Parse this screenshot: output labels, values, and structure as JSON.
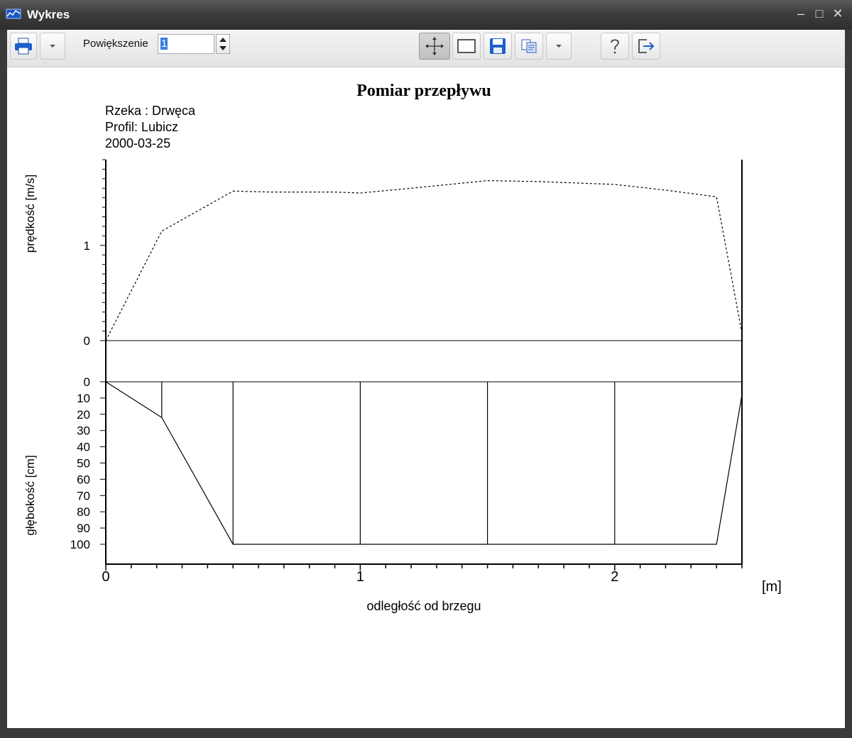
{
  "window": {
    "title": "Wykres",
    "accent": "#2a6fdb"
  },
  "toolbar": {
    "zoom_label": "Powiększenie",
    "zoom_value": "1",
    "icons": [
      "print-icon",
      "dropdown-icon",
      "pan-icon",
      "select-rect-icon",
      "save-icon",
      "copy-icon",
      "dropdown-icon",
      "help-icon",
      "exit-icon"
    ]
  },
  "chart_data": {
    "type": "line",
    "title": "Pomiar przepływu",
    "info": [
      "Rzeka : Drwęca",
      "Profil: Lubicz",
      "2000-03-25"
    ],
    "xlabel": "odległość od brzegu",
    "xunit": "[m]",
    "xlim": [
      0,
      2.5
    ],
    "xticks": [
      0,
      1,
      2
    ],
    "velocity": {
      "ylabel": "prędkość [m/s]",
      "ylim": [
        0,
        1.9
      ],
      "yticks": [
        0,
        1
      ],
      "style": "dashed",
      "x": [
        0,
        0.22,
        0.5,
        0.65,
        0.9,
        1.0,
        1.2,
        1.5,
        1.7,
        2.0,
        2.2,
        2.4,
        2.5
      ],
      "y": [
        0,
        1.15,
        1.57,
        1.56,
        1.56,
        1.55,
        1.6,
        1.68,
        1.67,
        1.64,
        1.58,
        1.51,
        0.08
      ]
    },
    "depth": {
      "ylabel": "głębokość [cm]",
      "ylim": [
        0,
        100
      ],
      "yticks": [
        0,
        10,
        20,
        30,
        40,
        50,
        60,
        70,
        80,
        90,
        100
      ],
      "x": [
        0,
        0.22,
        0.5,
        1.0,
        1.5,
        2.0,
        2.4,
        2.5
      ],
      "y": [
        0,
        22,
        100,
        100,
        100,
        100,
        100,
        8
      ],
      "verticals": [
        0.22,
        0.5,
        1.0,
        1.5,
        2.0
      ]
    }
  }
}
